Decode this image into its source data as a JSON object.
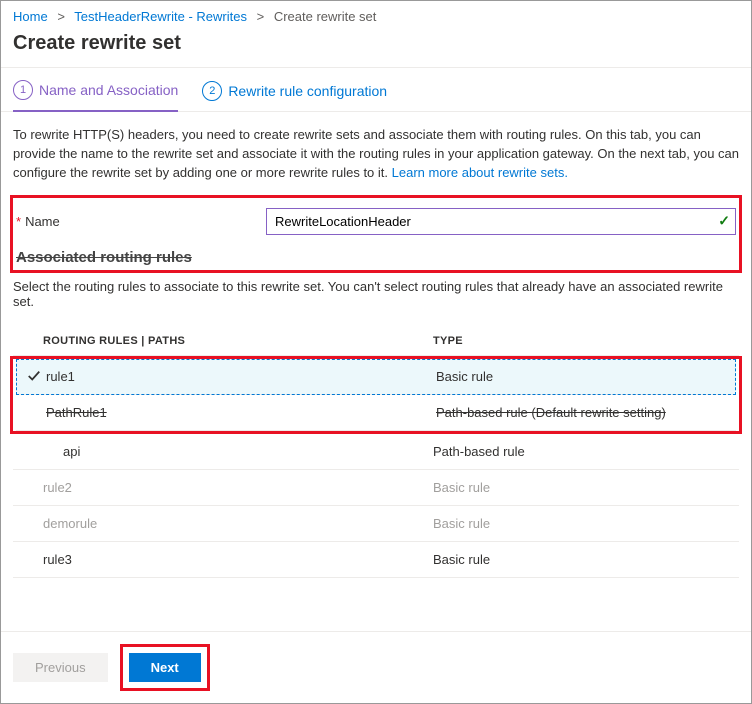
{
  "breadcrumb": {
    "items": [
      "Home",
      "TestHeaderRewrite - Rewrites",
      "Create rewrite set"
    ]
  },
  "page": {
    "title": "Create rewrite set"
  },
  "tabs": [
    {
      "num": "1",
      "label": "Name and Association"
    },
    {
      "num": "2",
      "label": "Rewrite rule configuration"
    }
  ],
  "intro": {
    "text": "To rewrite HTTP(S) headers, you need to create rewrite sets and associate them with routing rules. On this tab, you can provide the name to the rewrite set and associate it with the routing rules in your application gateway. On the next tab, you can configure the rewrite set by adding one or more rewrite rules to it.  ",
    "link": "Learn more about rewrite sets."
  },
  "form": {
    "name_label": "Name",
    "name_value": "RewriteLocationHeader"
  },
  "section": {
    "heading": "Associated routing rules",
    "sub": "Select the routing rules to associate to this rewrite set. You can't select routing rules that already have an associated rewrite set."
  },
  "table": {
    "head_name": "ROUTING RULES | PATHS",
    "head_type": "TYPE",
    "rows": [
      {
        "name": "rule1",
        "type": "Basic rule",
        "checked": true,
        "selected": true
      },
      {
        "name": "PathRule1",
        "type": "Path-based rule (Default rewrite setting)",
        "strike": true
      },
      {
        "name": "api",
        "type": "Path-based rule",
        "indent": true
      },
      {
        "name": "rule2",
        "type": "Basic rule",
        "disabled": true
      },
      {
        "name": "demorule",
        "type": "Basic rule",
        "disabled": true
      },
      {
        "name": "rule3",
        "type": "Basic rule"
      }
    ]
  },
  "footer": {
    "prev": "Previous",
    "next": "Next"
  }
}
